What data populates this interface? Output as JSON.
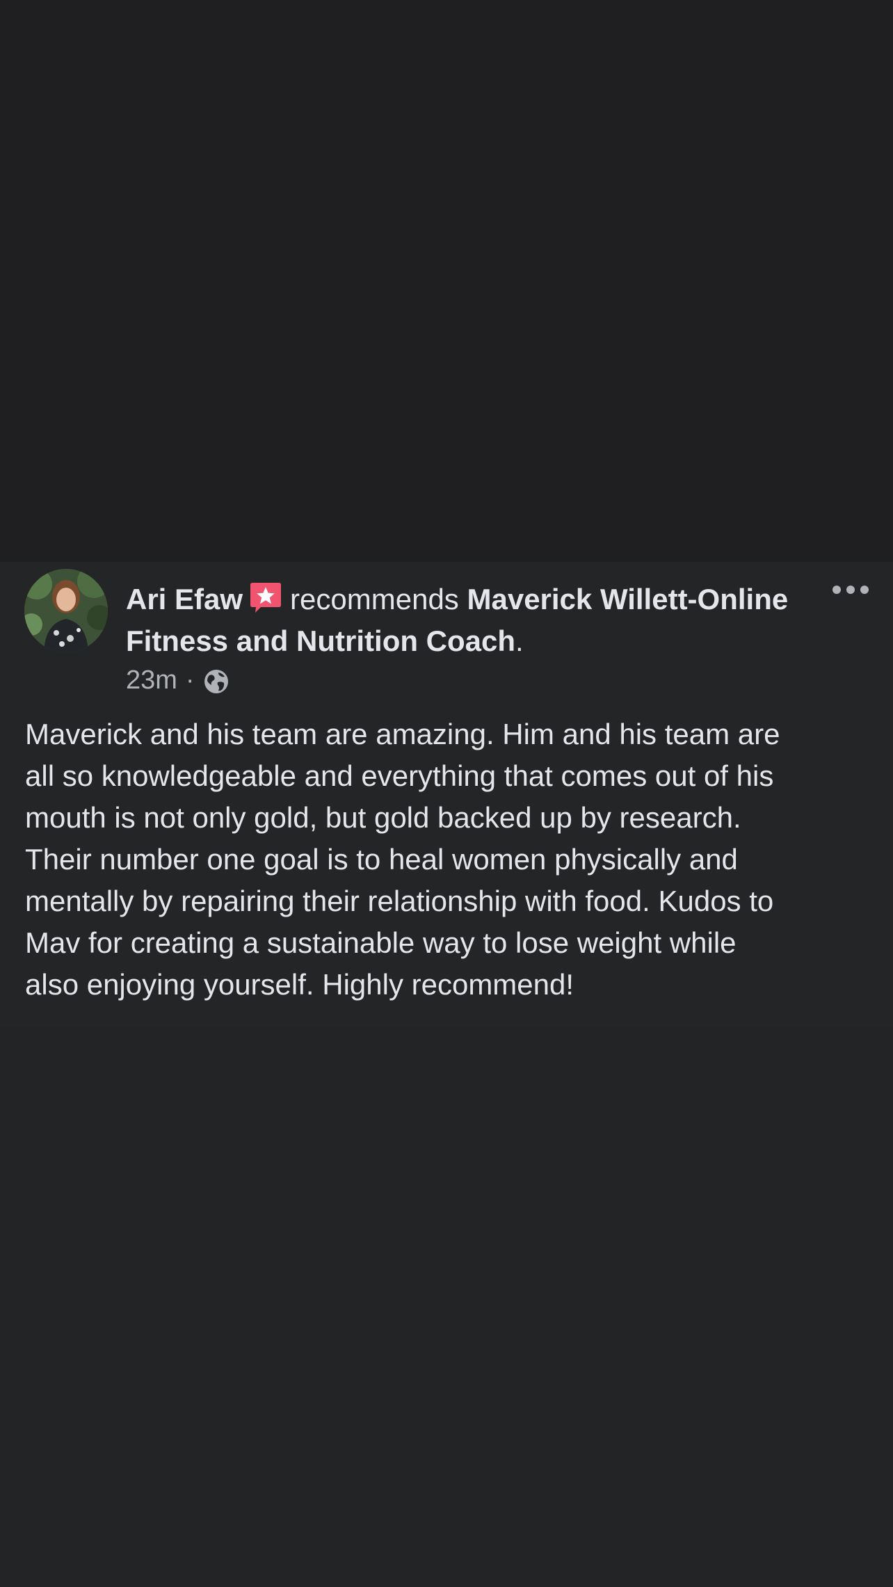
{
  "post": {
    "author": "Ari Efaw",
    "verb": "recommends",
    "page_name": "Maverick Willett-Online Fitness and Nutrition Coach",
    "end_punct": ".",
    "timestamp": "23m",
    "separator": "·",
    "visibility_icon": "globe-icon",
    "badge_icon": "recommendation-star-icon",
    "more_icon": "more-options-icon",
    "body_lines": [
      "Maverick and his team are amazing. Him and his team are",
      "all so knowledgeable and everything that comes out of his",
      "mouth is not only gold, but gold backed up by research.",
      "Their number one goal is to heal women physically and",
      "mentally by repairing their relationship with food. Kudos to",
      "Mav for creating a sustainable way to lose weight while",
      "also enjoying yourself. Highly recommend!"
    ]
  },
  "colors": {
    "background": "#1f1f21",
    "card": "#242527",
    "primary_text": "#e4e6eb",
    "secondary_text": "#b0b3b8",
    "badge": "#f0546f"
  }
}
